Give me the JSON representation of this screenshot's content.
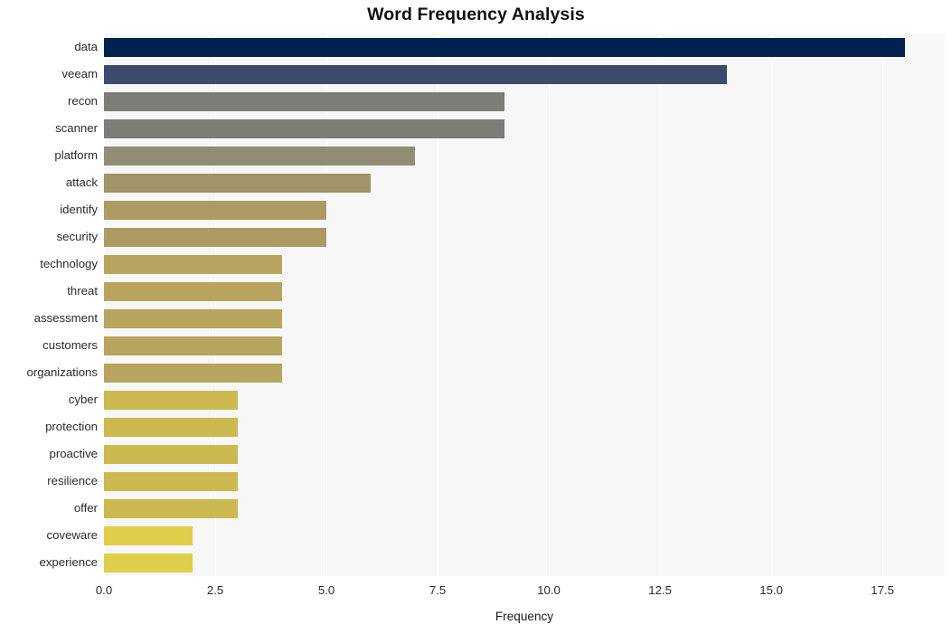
{
  "chart_data": {
    "type": "bar",
    "orientation": "horizontal",
    "title": "Word Frequency Analysis",
    "xlabel": "Frequency",
    "ylabel": "",
    "categories": [
      "data",
      "veeam",
      "recon",
      "scanner",
      "platform",
      "attack",
      "identify",
      "security",
      "technology",
      "threat",
      "assessment",
      "customers",
      "organizations",
      "cyber",
      "protection",
      "proactive",
      "resilience",
      "offer",
      "coveware",
      "experience"
    ],
    "values": [
      18,
      14,
      9,
      9,
      7,
      6,
      5,
      5,
      4,
      4,
      4,
      4,
      4,
      3,
      3,
      3,
      3,
      3,
      2,
      2
    ],
    "bar_colors": [
      "#00224e",
      "#3e4a6b",
      "#7d7c78",
      "#7d7c78",
      "#918d75",
      "#a09468",
      "#ab9b63",
      "#ab9b63",
      "#b7a55f",
      "#b7a55f",
      "#b7a55f",
      "#b7a55f",
      "#b7a55f",
      "#cbb94f",
      "#cbb94f",
      "#cbb94f",
      "#cbb94f",
      "#cbb94f",
      "#dfce49",
      "#dfce49"
    ],
    "xlim": [
      0,
      18.9
    ],
    "xticks": [
      0.0,
      2.5,
      5.0,
      7.5,
      10.0,
      12.5,
      15.0,
      17.5
    ],
    "xticklabels": [
      "0.0",
      "2.5",
      "5.0",
      "7.5",
      "10.0",
      "12.5",
      "15.0",
      "17.5"
    ],
    "grid": true,
    "grid_axis": "x",
    "grid_color": "#ffffff",
    "legend": null,
    "plot_background": "#f7f7f7",
    "figure_background": "#ffffff",
    "colormap": "cividis"
  }
}
